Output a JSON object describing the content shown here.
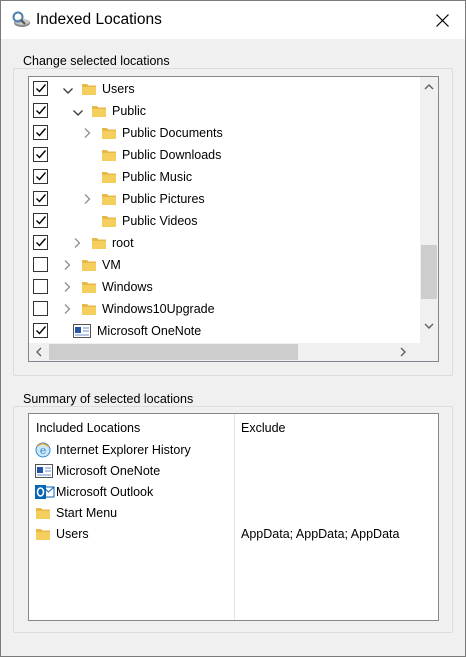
{
  "window": {
    "title": "Indexed Locations",
    "close_glyph": "✕"
  },
  "change_group": {
    "label": "Change selected locations",
    "items": [
      {
        "label": "Users",
        "checked": true,
        "indent": 0,
        "expander": "expanded",
        "icon": "folder-icon"
      },
      {
        "label": "Public",
        "checked": true,
        "indent": 1,
        "expander": "expanded",
        "icon": "folder-icon"
      },
      {
        "label": "Public Documents",
        "checked": true,
        "indent": 2,
        "expander": "collapsed",
        "icon": "folder-icon"
      },
      {
        "label": "Public Downloads",
        "checked": true,
        "indent": 2,
        "expander": "none",
        "icon": "folder-icon"
      },
      {
        "label": "Public Music",
        "checked": true,
        "indent": 2,
        "expander": "none",
        "icon": "folder-icon"
      },
      {
        "label": "Public Pictures",
        "checked": true,
        "indent": 2,
        "expander": "collapsed",
        "icon": "folder-icon"
      },
      {
        "label": "Public Videos",
        "checked": true,
        "indent": 2,
        "expander": "none",
        "icon": "folder-icon"
      },
      {
        "label": "root",
        "checked": true,
        "indent": 1,
        "expander": "collapsed",
        "icon": "folder-icon"
      },
      {
        "label": "VM",
        "checked": false,
        "indent": 0,
        "expander": "collapsed",
        "icon": "folder-icon"
      },
      {
        "label": "Windows",
        "checked": false,
        "indent": 0,
        "expander": "collapsed",
        "icon": "folder-icon"
      },
      {
        "label": "Windows10Upgrade",
        "checked": false,
        "indent": 0,
        "expander": "collapsed",
        "icon": "folder-icon"
      },
      {
        "label": "Microsoft OneNote",
        "checked": true,
        "indent": -1,
        "expander": "none",
        "icon": "onenote-icon"
      }
    ]
  },
  "summary_group": {
    "label": "Summary of selected locations",
    "col_included": "Included Locations",
    "col_exclude": "Exclude",
    "rows": [
      {
        "label": "Internet Explorer History",
        "exclude": "",
        "icon": "ie-history-icon"
      },
      {
        "label": "Microsoft OneNote",
        "exclude": "",
        "icon": "onenote-icon"
      },
      {
        "label": "Microsoft Outlook",
        "exclude": "",
        "icon": "outlook-icon"
      },
      {
        "label": "Start Menu",
        "exclude": "",
        "icon": "folder-icon"
      },
      {
        "label": "Users",
        "exclude": "AppData; AppData; AppData",
        "icon": "folder-icon"
      }
    ]
  },
  "colors": {
    "folder": "#e8b94a",
    "folder_front": "#f5cf5e",
    "outlook_blue": "#0a64b4",
    "ie_blue": "#2a8ad4"
  }
}
